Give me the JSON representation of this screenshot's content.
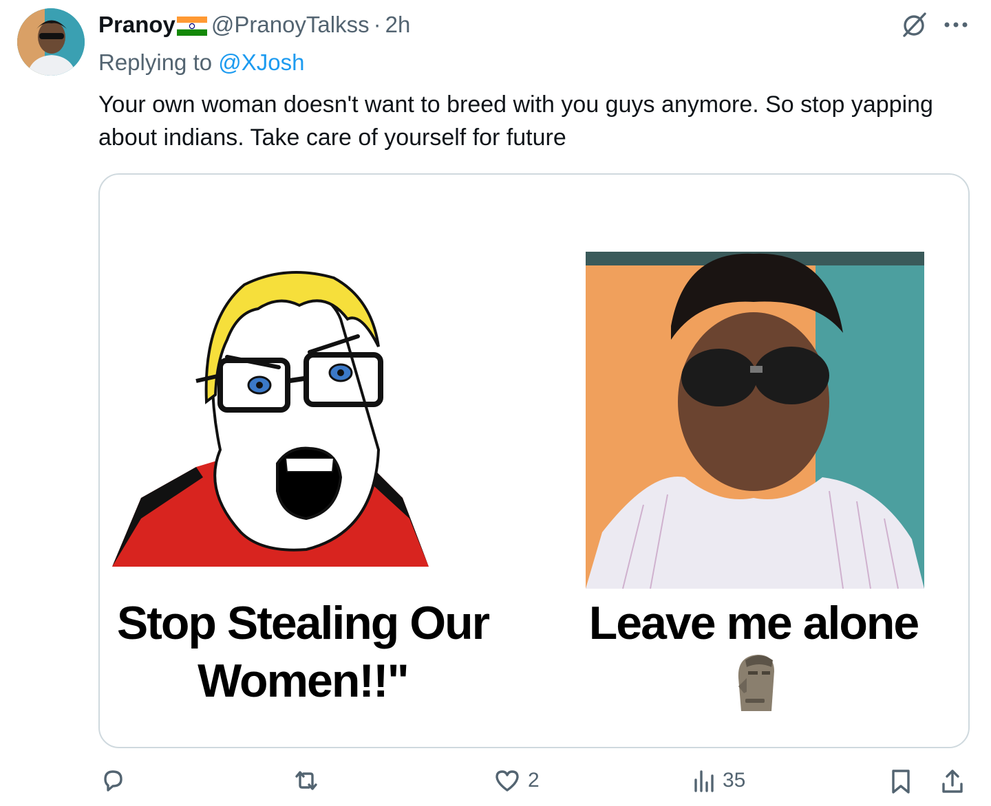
{
  "tweet": {
    "display_name": "Pranoy",
    "flag_icon": "india-flag-icon",
    "handle": "@PranoyTalkss",
    "separator": "·",
    "time": "2h",
    "replying_prefix": "Replying to",
    "replying_to": "@XJosh",
    "text": "Your own woman doesn't want to breed with you guys anymore. So stop yapping about indians. Take care of yourself for future"
  },
  "media": {
    "left_caption": "Stop Stealing Our Women!!\"",
    "right_caption": "Leave me alone",
    "right_emoji_icon": "moai-icon"
  },
  "actions": {
    "reply_count": "",
    "retweet_count": "",
    "like_count": "2",
    "views_count": "35"
  },
  "colors": {
    "text": "#0f1419",
    "muted": "#536471",
    "link": "#1d9bf0",
    "border": "#cfd9de"
  }
}
